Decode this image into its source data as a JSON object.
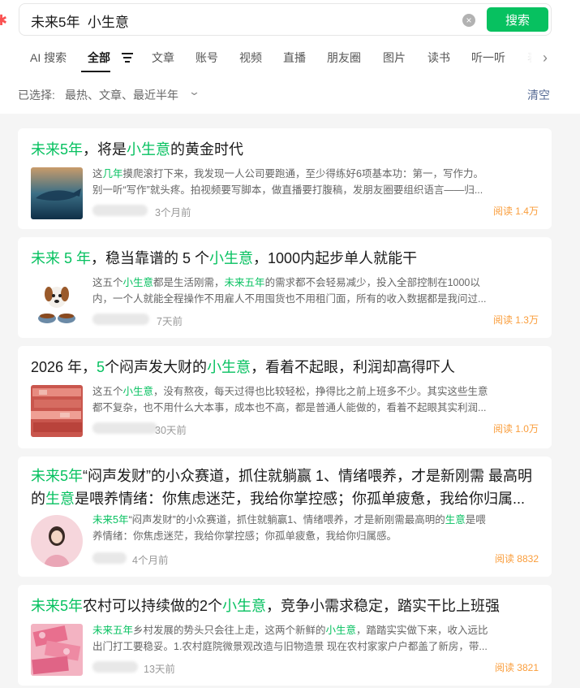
{
  "search": {
    "query": "未来5年  小生意",
    "button_label": "搜索"
  },
  "tabs": [
    {
      "label": "AI 搜索"
    },
    {
      "label": "全部"
    },
    {
      "label": "文章"
    },
    {
      "label": "账号"
    },
    {
      "label": "视频"
    },
    {
      "label": "直播"
    },
    {
      "label": "朋友圈"
    },
    {
      "label": "图片"
    },
    {
      "label": "读书"
    },
    {
      "label": "听一听"
    },
    {
      "label": "表"
    }
  ],
  "filter": {
    "prefix": "已选择:",
    "values": "最热、文章、最近半年",
    "clear_label": "清空"
  },
  "results": [
    {
      "title": [
        {
          "t": "未来5年",
          "h": true
        },
        {
          "t": "，将是",
          "h": false
        },
        {
          "t": "小生意",
          "h": true
        },
        {
          "t": "的黄金时代",
          "h": false
        }
      ],
      "snippet1": [
        {
          "t": "这",
          "h": false
        },
        {
          "t": "几年",
          "h": true
        },
        {
          "t": "摸爬滚打下来，我发现一人公司要跑通，至少得练好6项基本功：第一，写作力。",
          "h": false
        }
      ],
      "snippet2": [
        {
          "t": "别一听“写作”就头疼。拍视频要写脚本，做直播要打腹稿，发朋友圈要组织语言——归...",
          "h": false
        }
      ],
      "time": "3个月前",
      "reads": "阅读 1.4万"
    },
    {
      "title": [
        {
          "t": "未来 5 年",
          "h": true
        },
        {
          "t": "，稳当靠谱的 5 个",
          "h": false
        },
        {
          "t": "小生意",
          "h": true
        },
        {
          "t": "，1000内起步单人就能干",
          "h": false
        }
      ],
      "snippet1": [
        {
          "t": "这五个",
          "h": false
        },
        {
          "t": "小生意",
          "h": true
        },
        {
          "t": "都是生活刚需，",
          "h": false
        },
        {
          "t": "未来五年",
          "h": true
        },
        {
          "t": "的需求都不会轻易减少，投入全部控制在1000以",
          "h": false
        }
      ],
      "snippet2": [
        {
          "t": "内，一个人就能全程操作不用雇人不用囤货也不用租门面，所有的收入数据都是我问过...",
          "h": false
        }
      ],
      "time": "7天前",
      "reads": "阅读 1.3万"
    },
    {
      "title": [
        {
          "t": "2026 年，",
          "h": false
        },
        {
          "t": "5",
          "h": true
        },
        {
          "t": "个闷声发大财的",
          "h": false
        },
        {
          "t": "小生意",
          "h": true
        },
        {
          "t": "，看着不起眼，利润却高得吓人",
          "h": false
        }
      ],
      "snippet1": [
        {
          "t": "这五个",
          "h": false
        },
        {
          "t": "小生意",
          "h": true
        },
        {
          "t": "，没有熬夜，每天过得也比较轻松，挣得比之前上班多不少。其实这些生意",
          "h": false
        }
      ],
      "snippet2": [
        {
          "t": "都不复杂，也不用什么大本事，成本也不高，都是普通人能做的，看着不起眼其实利润...",
          "h": false
        }
      ],
      "time": "30天前",
      "reads": "阅读 1.0万"
    },
    {
      "title": [
        {
          "t": "未来5年",
          "h": true
        },
        {
          "t": "“闷声发财”的小众赛道，抓住就躺赢 1、情绪喂养，才是新刚需 最高明",
          "h": false
        }
      ],
      "title2": [
        {
          "t": "的",
          "h": false
        },
        {
          "t": "生意",
          "h": true
        },
        {
          "t": "是喂养情绪：你焦虑迷茫，我给你掌控感；你孤单疲惫，我给你归属...",
          "h": false
        }
      ],
      "snippet1": [
        {
          "t": "未来5年",
          "h": true
        },
        {
          "t": "“闷声发财”的小众赛道，抓住就躺赢1、情绪喂养，才是新刚需最高明的",
          "h": false
        },
        {
          "t": "生意",
          "h": true
        },
        {
          "t": "是喂",
          "h": false
        }
      ],
      "snippet2": [
        {
          "t": "养情绪：你焦虑迷茫，我给你掌控感；你孤单疲惫，我给你归属感。",
          "h": false
        }
      ],
      "time": "4个月前",
      "reads": "阅读 8832"
    },
    {
      "title": [
        {
          "t": "未来5年",
          "h": true
        },
        {
          "t": "农村可以持续做的2个",
          "h": false
        },
        {
          "t": "小生意",
          "h": true
        },
        {
          "t": "，竞争小需求稳定，踏实干比上班强",
          "h": false
        }
      ],
      "snippet1": [
        {
          "t": "未来五年",
          "h": true
        },
        {
          "t": "乡村发展的势头只会往上走，这两个新鲜的",
          "h": false
        },
        {
          "t": "小生意",
          "h": true
        },
        {
          "t": "，踏踏实实做下来，收入远比",
          "h": false
        }
      ],
      "snippet2": [
        {
          "t": "出门打工要稳妥。1.农村庭院微景观改造与旧物造景 现在农村家家户户都盖了新房，带...",
          "h": false
        }
      ],
      "time": "13天前",
      "reads": "阅读 3821"
    }
  ]
}
